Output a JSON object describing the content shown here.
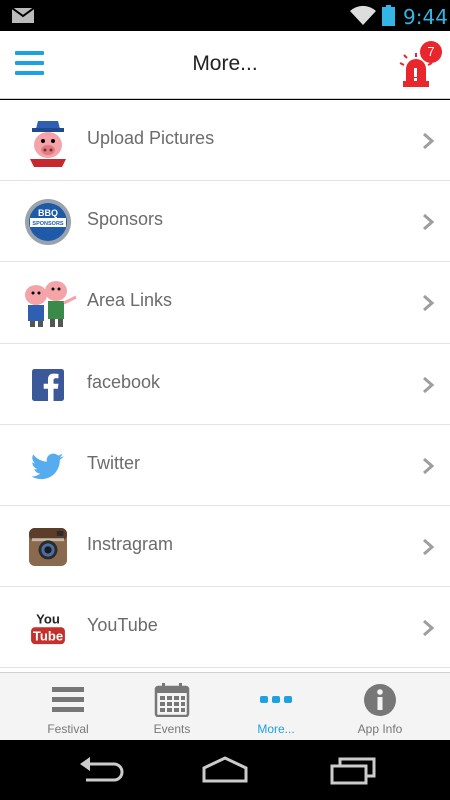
{
  "status_bar": {
    "time": "9:44",
    "icons": [
      "mail-icon",
      "wifi-icon",
      "battery-icon"
    ]
  },
  "header": {
    "title": "More...",
    "menu_icon": "hamburger-menu-icon",
    "alert_icon": "siren-alert-icon",
    "alert_count": "7"
  },
  "list": {
    "items": [
      {
        "label": "Upload Pictures",
        "icon": "pig-mascot-icon"
      },
      {
        "label": "Sponsors",
        "icon": "bbq-sponsors-badge-icon"
      },
      {
        "label": "Area Links",
        "icon": "two-pigs-icon"
      },
      {
        "label": "facebook",
        "icon": "facebook-icon"
      },
      {
        "label": "Twitter",
        "icon": "twitter-bird-icon"
      },
      {
        "label": "Instragram",
        "icon": "instagram-camera-icon"
      },
      {
        "label": "YouTube",
        "icon": "youtube-icon"
      }
    ],
    "badge_text": "BBQ SPONSORS",
    "youtube_text": {
      "you": "You",
      "tube": "Tube"
    }
  },
  "tabs": [
    {
      "label": "Festival",
      "icon": "list-icon",
      "active": false
    },
    {
      "label": "Events",
      "icon": "calendar-icon",
      "active": false
    },
    {
      "label": "More...",
      "icon": "more-dots-icon",
      "active": true
    },
    {
      "label": "App Info",
      "icon": "info-icon",
      "active": false
    }
  ],
  "colors": {
    "accent": "#1da1e0",
    "alert_red": "#e8262b",
    "label_gray": "#6b6b6b"
  }
}
